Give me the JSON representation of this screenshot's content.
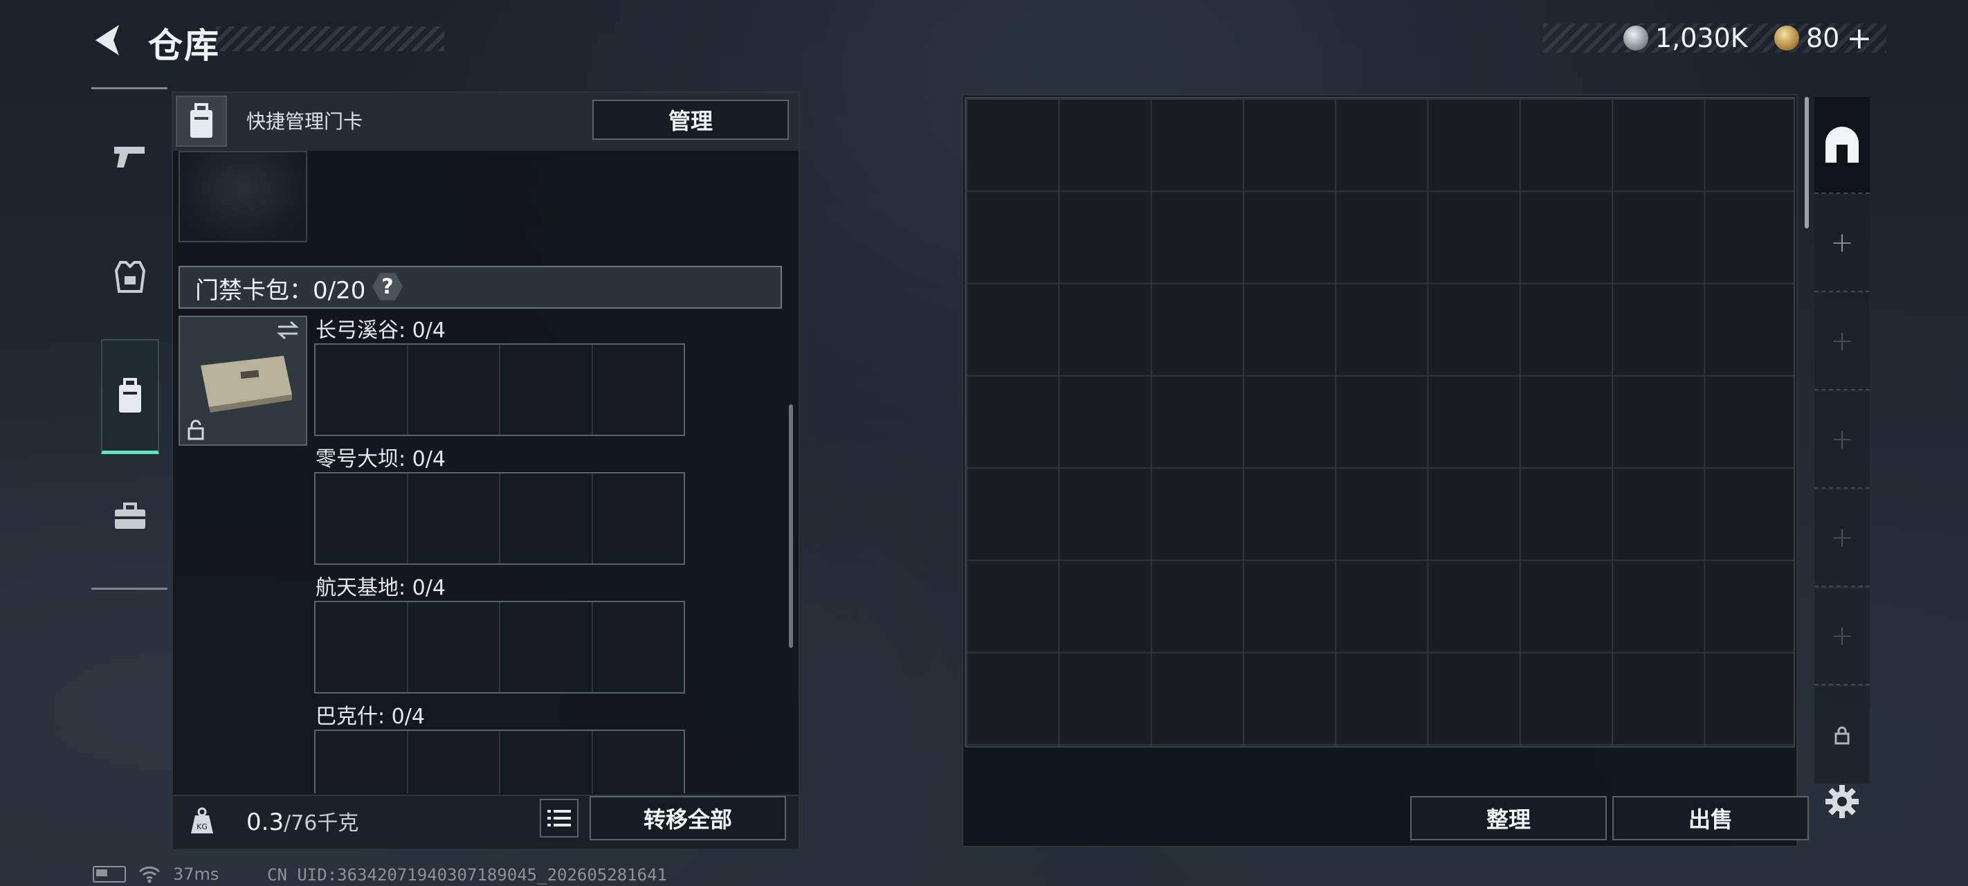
{
  "header": {
    "title": "仓库",
    "back_icon": "back-arrow-icon",
    "currencies": [
      {
        "icon": "silver-coin-icon",
        "value": "1,030K",
        "color": "#b9bec4"
      },
      {
        "icon": "gold-triangle-coin-icon",
        "value": "80",
        "color": "#c9a85a",
        "plus": "+"
      }
    ]
  },
  "categories": [
    {
      "icon": "pistol-icon",
      "active": false
    },
    {
      "icon": "armor-vest-icon",
      "active": false
    },
    {
      "icon": "keycard-icon",
      "active": true
    },
    {
      "icon": "toolbox-icon",
      "active": false
    }
  ],
  "panel": {
    "header_text": "快捷管理门卡",
    "manage_label": "管理",
    "keybag_label": "门禁卡包：0/20",
    "help_label": "?",
    "maps": [
      {
        "label": "长弓溪谷: 0/4"
      },
      {
        "label": "零号大坝: 0/4"
      },
      {
        "label": "航天基地: 0/4"
      },
      {
        "label": "巴克什: 0/4"
      }
    ],
    "weight_value": "0.3",
    "weight_max": "/76千克",
    "transfer_all_label": "转移全部"
  },
  "stash": {
    "sort_label": "整理",
    "sell_label": "出售",
    "tabs": [
      "main-stash-icon",
      "add-icon",
      "add-icon",
      "add-icon",
      "add-icon",
      "add-icon",
      "lock-icon"
    ],
    "settings_icon": "gear-icon"
  },
  "status": {
    "ping": "37ms",
    "uid": "CN UID:36342071940307189045_202605281641"
  },
  "colors": {
    "accent": "#5ce3c4",
    "button_border": "#59626b"
  }
}
